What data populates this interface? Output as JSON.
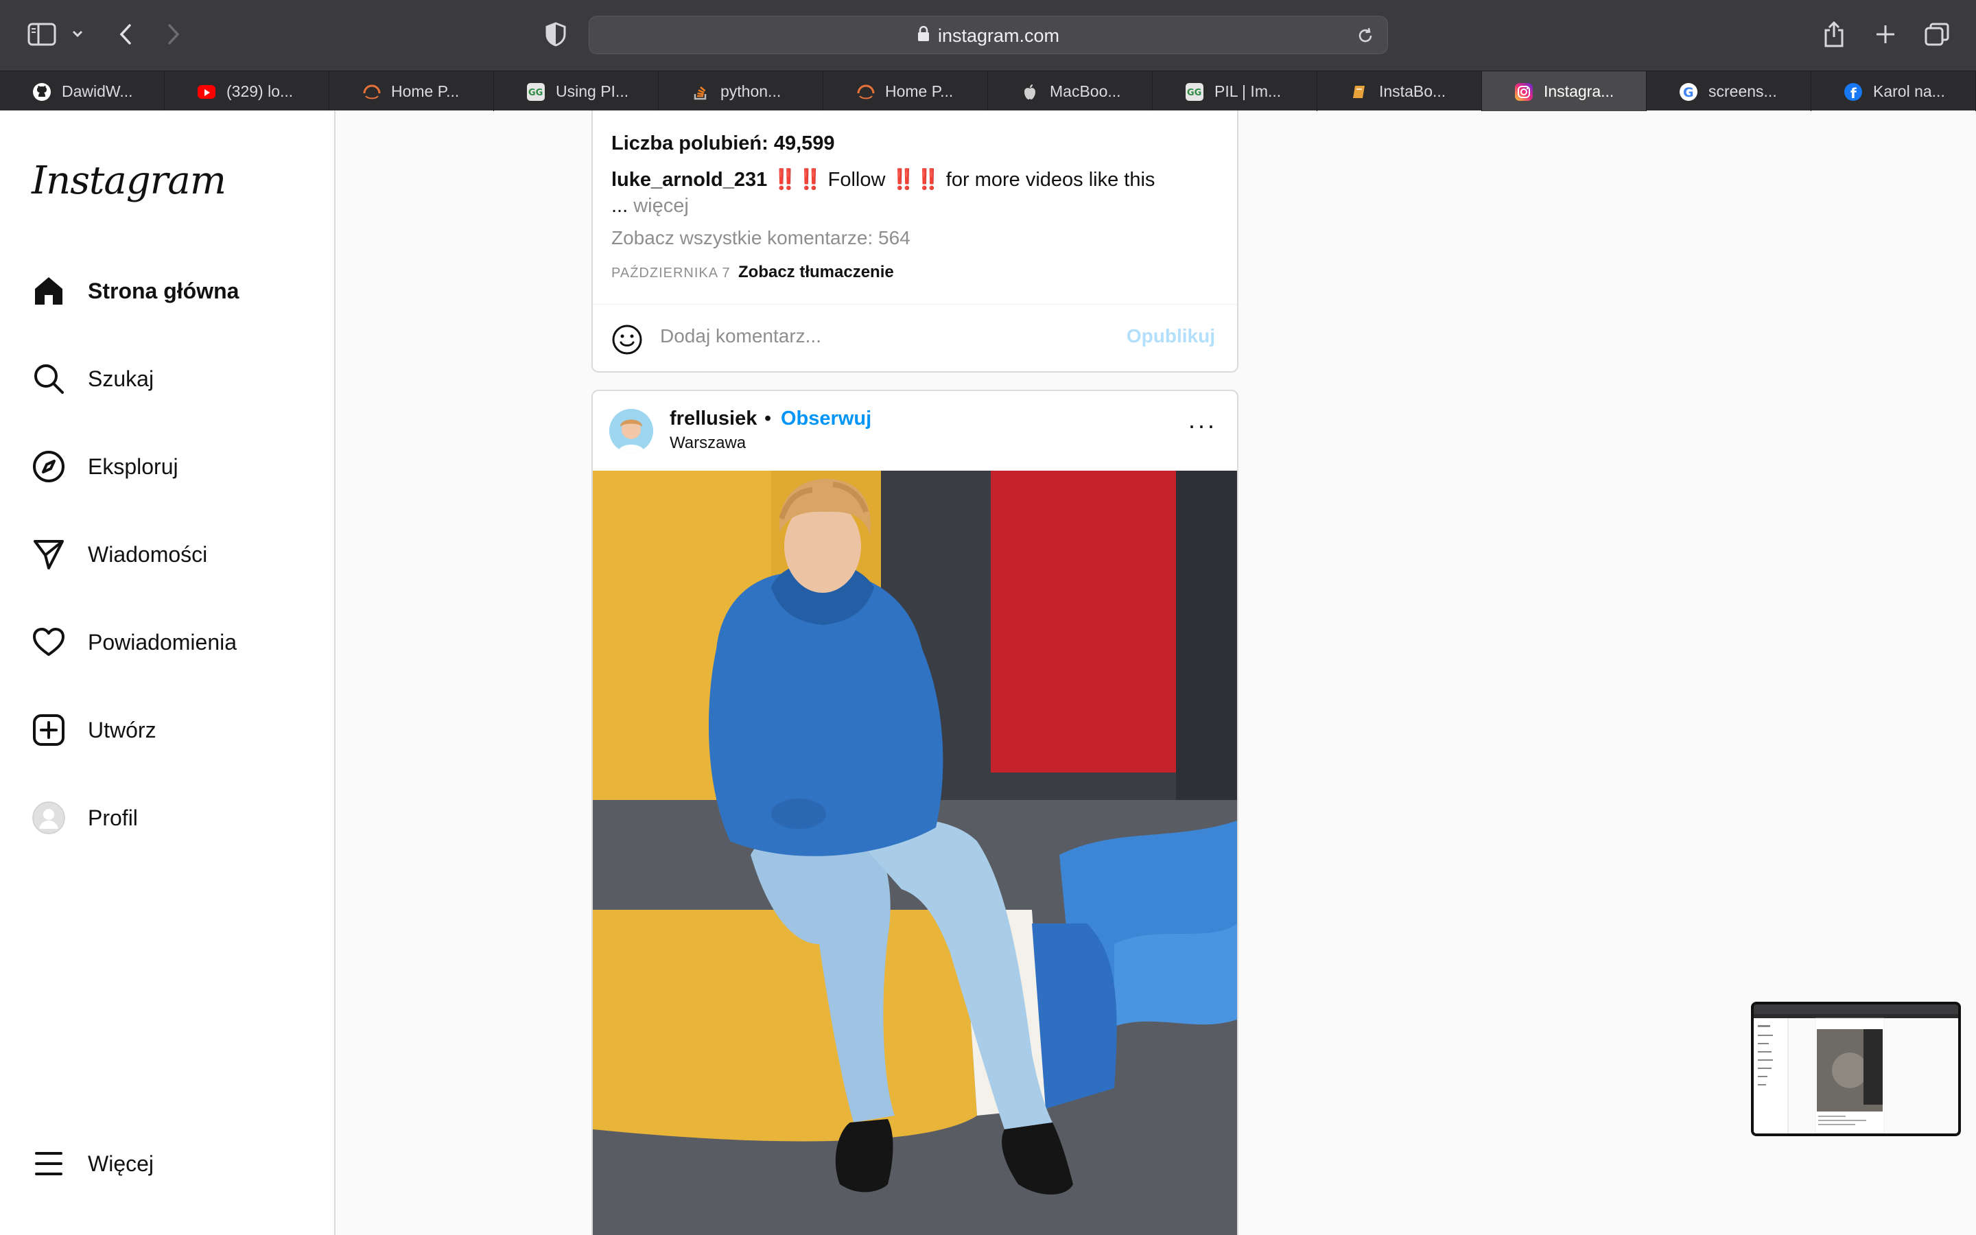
{
  "browser": {
    "url": "instagram.com",
    "tabs": [
      {
        "label": "DawidW...",
        "icon": "github-icon",
        "color": "#ffffff"
      },
      {
        "label": "(329) lo...",
        "icon": "youtube-icon",
        "color": "#ff0000"
      },
      {
        "label": "Home P...",
        "icon": "loading-arc-icon",
        "color": "#e8713a"
      },
      {
        "label": "Using PI...",
        "icon": "geeksforgeeks-icon",
        "color": "#2f8d46"
      },
      {
        "label": "python...",
        "icon": "stackoverflow-icon",
        "color": "#f48024"
      },
      {
        "label": "Home P...",
        "icon": "loading-arc-icon",
        "color": "#e8713a"
      },
      {
        "label": "MacBoo...",
        "icon": "apple-icon",
        "color": "#d0d0d0"
      },
      {
        "label": "PIL | Im...",
        "icon": "geeksforgeeks-icon",
        "color": "#2f8d46"
      },
      {
        "label": "InstaBo...",
        "icon": "book-icon",
        "color": "#e8a33a"
      },
      {
        "label": "Instagra...",
        "icon": "instagram-icon",
        "color": "#d6249f",
        "active": true
      },
      {
        "label": "screens...",
        "icon": "google-icon",
        "color": "#4285f4"
      },
      {
        "label": "Karol na...",
        "icon": "facebook-icon",
        "color": "#1877f2"
      }
    ]
  },
  "sidebar": {
    "logo": "Instagram",
    "items": [
      {
        "label": "Strona główna",
        "icon": "home-icon"
      },
      {
        "label": "Szukaj",
        "icon": "search-icon"
      },
      {
        "label": "Eksploruj",
        "icon": "compass-icon"
      },
      {
        "label": "Wiadomości",
        "icon": "send-icon"
      },
      {
        "label": "Powiadomienia",
        "icon": "heart-icon"
      },
      {
        "label": "Utwórz",
        "icon": "plus-square-icon"
      },
      {
        "label": "Profil",
        "icon": "profile-avatar-icon"
      }
    ],
    "more": "Więcej"
  },
  "post1": {
    "likes": "Liczba polubień: 49,599",
    "author": "luke_arnold_231",
    "bang1": "‼️‼️",
    "caption_follow": "Follow",
    "bang2": "‼️‼️",
    "caption_rest": "for more videos like this",
    "ellipsis": "...",
    "more": "więcej",
    "all_comments": "Zobacz wszystkie komentarze: 564",
    "date": "PAŹDZIERNIKA 7",
    "translate": "Zobacz tłumaczenie",
    "comment_placeholder": "Dodaj komentarz...",
    "publish": "Opublikuj"
  },
  "post2": {
    "username": "frellusiek",
    "separator": "•",
    "follow": "Obserwuj",
    "location": "Warszawa",
    "menu": "···"
  },
  "colors": {
    "accent": "#0095f6",
    "publish_disabled": "#b2dffc",
    "hoodie": "#2f73c2",
    "bench": "#e8b43a"
  }
}
